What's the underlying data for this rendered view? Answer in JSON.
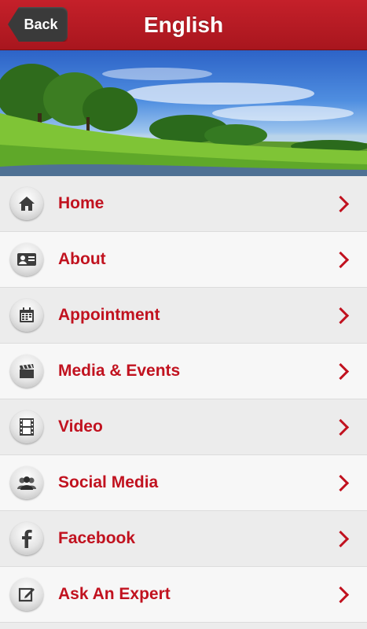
{
  "navbar": {
    "back_label": "Back",
    "title": "English"
  },
  "menu": [
    {
      "label": "Home",
      "icon": "home-icon"
    },
    {
      "label": "About",
      "icon": "id-card-icon"
    },
    {
      "label": "Appointment",
      "icon": "calendar-icon"
    },
    {
      "label": "Media & Events",
      "icon": "clapperboard-icon"
    },
    {
      "label": "Video",
      "icon": "film-icon"
    },
    {
      "label": "Social Media",
      "icon": "people-icon"
    },
    {
      "label": "Facebook",
      "icon": "facebook-icon"
    },
    {
      "label": "Ask An Expert",
      "icon": "edit-icon"
    }
  ],
  "colors": {
    "accent": "#c1121f",
    "navbar": "#b51a23"
  }
}
